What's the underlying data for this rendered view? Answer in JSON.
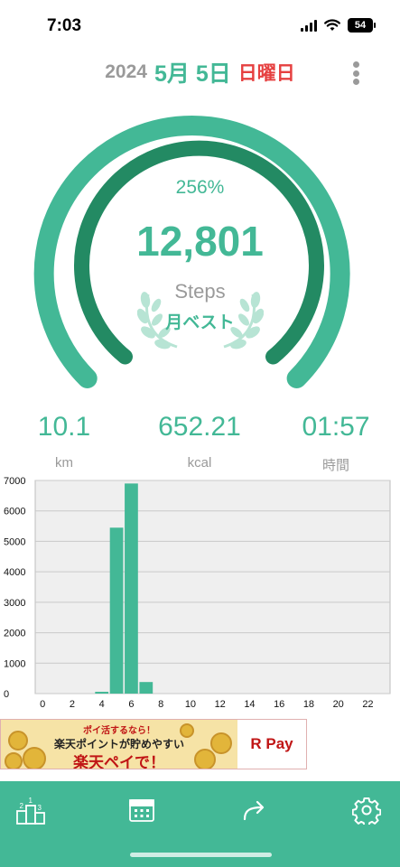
{
  "status_bar": {
    "time": "7:03",
    "battery": "54"
  },
  "header": {
    "year": "2024",
    "month_day": "5月 5日",
    "weekday": "日曜日",
    "menu_icon": "more-vertical-icon"
  },
  "summary": {
    "percent": "256%",
    "steps": "12,801",
    "steps_label": "Steps",
    "badge": "月ベスト",
    "goal_progress_fraction": 1.0
  },
  "stats": [
    {
      "value": "10.1",
      "unit": "km"
    },
    {
      "value": "652.21",
      "unit": "kcal"
    },
    {
      "value": "01:57",
      "unit": "時間"
    }
  ],
  "chart_data": {
    "type": "bar",
    "x_ticks": [
      "0",
      "2",
      "4",
      "6",
      "8",
      "10",
      "12",
      "14",
      "16",
      "18",
      "20",
      "22"
    ],
    "y_ticks": [
      "0",
      "1000",
      "2000",
      "3000",
      "4000",
      "5000",
      "6000",
      "7000"
    ],
    "ylim": [
      0,
      7000
    ],
    "xlim": [
      -0.5,
      23.5
    ],
    "hours": [
      0,
      1,
      2,
      3,
      4,
      5,
      6,
      7,
      8,
      9,
      10,
      11,
      12,
      13,
      14,
      15,
      16,
      17,
      18,
      19,
      20,
      21,
      22,
      23
    ],
    "values": [
      0,
      0,
      0,
      0,
      60,
      5450,
      6900,
      380,
      0,
      0,
      0,
      0,
      0,
      0,
      0,
      0,
      0,
      0,
      0,
      0,
      0,
      0,
      0,
      0
    ],
    "grid": true,
    "colors": {
      "bar": "#43b896",
      "plot_bg": "#efefef",
      "grid": "#c9c9c9"
    }
  },
  "ad": {
    "line1": "ポイ活するなら！",
    "line2": "楽天ポイントが貯めやすい",
    "line3": "楽天ペイで！",
    "brand": "R Pay"
  },
  "bottom_nav": [
    {
      "name": "ranking-icon"
    },
    {
      "name": "calendar-icon"
    },
    {
      "name": "share-icon"
    },
    {
      "name": "settings-icon"
    }
  ],
  "colors": {
    "accent": "#43b896",
    "accent_dark": "#238a63",
    "weekday": "#e64040",
    "muted": "#9a9a9a"
  }
}
